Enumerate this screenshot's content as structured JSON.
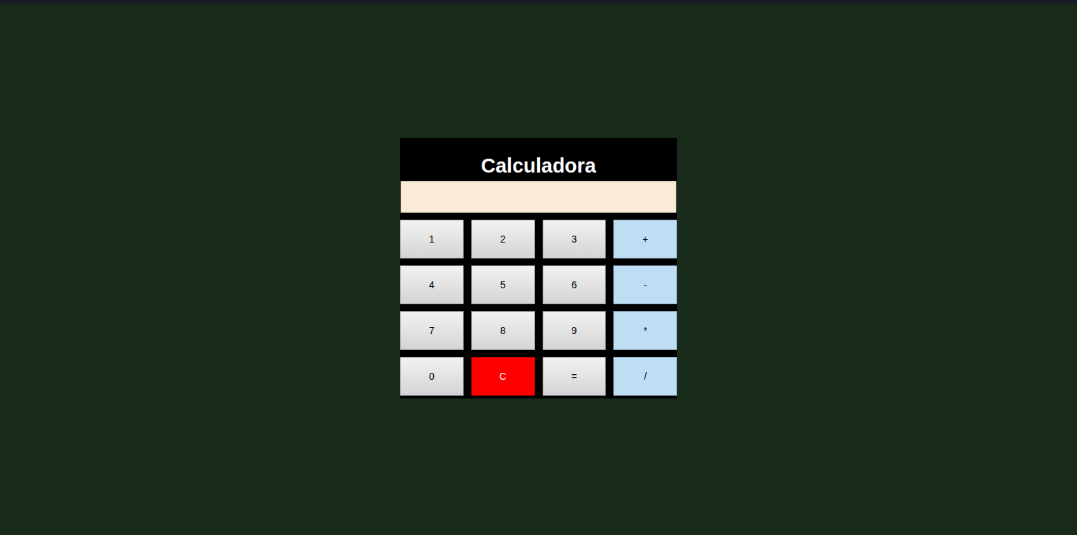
{
  "calculator": {
    "title": "Calculadora",
    "display": {
      "value": ""
    },
    "keys": [
      {
        "label": "1",
        "kind": "digit"
      },
      {
        "label": "2",
        "kind": "digit"
      },
      {
        "label": "3",
        "kind": "digit"
      },
      {
        "label": "+",
        "kind": "operator"
      },
      {
        "label": "4",
        "kind": "digit"
      },
      {
        "label": "5",
        "kind": "digit"
      },
      {
        "label": "6",
        "kind": "digit"
      },
      {
        "label": "-",
        "kind": "operator"
      },
      {
        "label": "7",
        "kind": "digit"
      },
      {
        "label": "8",
        "kind": "digit"
      },
      {
        "label": "9",
        "kind": "digit"
      },
      {
        "label": "*",
        "kind": "operator"
      },
      {
        "label": "0",
        "kind": "digit"
      },
      {
        "label": "C",
        "kind": "clear"
      },
      {
        "label": "=",
        "kind": "equals"
      },
      {
        "label": "/",
        "kind": "operator"
      }
    ]
  }
}
